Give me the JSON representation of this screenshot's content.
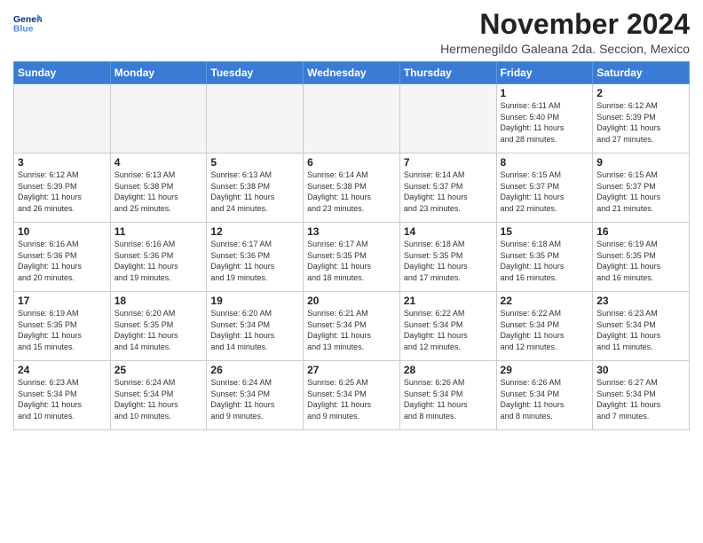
{
  "logo": {
    "line1": "General",
    "line2": "Blue"
  },
  "title": "November 2024",
  "location": "Hermenegildo Galeana 2da. Seccion, Mexico",
  "weekdays": [
    "Sunday",
    "Monday",
    "Tuesday",
    "Wednesday",
    "Thursday",
    "Friday",
    "Saturday"
  ],
  "weeks": [
    [
      {
        "day": "",
        "detail": ""
      },
      {
        "day": "",
        "detail": ""
      },
      {
        "day": "",
        "detail": ""
      },
      {
        "day": "",
        "detail": ""
      },
      {
        "day": "",
        "detail": ""
      },
      {
        "day": "1",
        "detail": "Sunrise: 6:11 AM\nSunset: 5:40 PM\nDaylight: 11 hours\nand 28 minutes."
      },
      {
        "day": "2",
        "detail": "Sunrise: 6:12 AM\nSunset: 5:39 PM\nDaylight: 11 hours\nand 27 minutes."
      }
    ],
    [
      {
        "day": "3",
        "detail": "Sunrise: 6:12 AM\nSunset: 5:39 PM\nDaylight: 11 hours\nand 26 minutes."
      },
      {
        "day": "4",
        "detail": "Sunrise: 6:13 AM\nSunset: 5:38 PM\nDaylight: 11 hours\nand 25 minutes."
      },
      {
        "day": "5",
        "detail": "Sunrise: 6:13 AM\nSunset: 5:38 PM\nDaylight: 11 hours\nand 24 minutes."
      },
      {
        "day": "6",
        "detail": "Sunrise: 6:14 AM\nSunset: 5:38 PM\nDaylight: 11 hours\nand 23 minutes."
      },
      {
        "day": "7",
        "detail": "Sunrise: 6:14 AM\nSunset: 5:37 PM\nDaylight: 11 hours\nand 23 minutes."
      },
      {
        "day": "8",
        "detail": "Sunrise: 6:15 AM\nSunset: 5:37 PM\nDaylight: 11 hours\nand 22 minutes."
      },
      {
        "day": "9",
        "detail": "Sunrise: 6:15 AM\nSunset: 5:37 PM\nDaylight: 11 hours\nand 21 minutes."
      }
    ],
    [
      {
        "day": "10",
        "detail": "Sunrise: 6:16 AM\nSunset: 5:36 PM\nDaylight: 11 hours\nand 20 minutes."
      },
      {
        "day": "11",
        "detail": "Sunrise: 6:16 AM\nSunset: 5:36 PM\nDaylight: 11 hours\nand 19 minutes."
      },
      {
        "day": "12",
        "detail": "Sunrise: 6:17 AM\nSunset: 5:36 PM\nDaylight: 11 hours\nand 19 minutes."
      },
      {
        "day": "13",
        "detail": "Sunrise: 6:17 AM\nSunset: 5:35 PM\nDaylight: 11 hours\nand 18 minutes."
      },
      {
        "day": "14",
        "detail": "Sunrise: 6:18 AM\nSunset: 5:35 PM\nDaylight: 11 hours\nand 17 minutes."
      },
      {
        "day": "15",
        "detail": "Sunrise: 6:18 AM\nSunset: 5:35 PM\nDaylight: 11 hours\nand 16 minutes."
      },
      {
        "day": "16",
        "detail": "Sunrise: 6:19 AM\nSunset: 5:35 PM\nDaylight: 11 hours\nand 16 minutes."
      }
    ],
    [
      {
        "day": "17",
        "detail": "Sunrise: 6:19 AM\nSunset: 5:35 PM\nDaylight: 11 hours\nand 15 minutes."
      },
      {
        "day": "18",
        "detail": "Sunrise: 6:20 AM\nSunset: 5:35 PM\nDaylight: 11 hours\nand 14 minutes."
      },
      {
        "day": "19",
        "detail": "Sunrise: 6:20 AM\nSunset: 5:34 PM\nDaylight: 11 hours\nand 14 minutes."
      },
      {
        "day": "20",
        "detail": "Sunrise: 6:21 AM\nSunset: 5:34 PM\nDaylight: 11 hours\nand 13 minutes."
      },
      {
        "day": "21",
        "detail": "Sunrise: 6:22 AM\nSunset: 5:34 PM\nDaylight: 11 hours\nand 12 minutes."
      },
      {
        "day": "22",
        "detail": "Sunrise: 6:22 AM\nSunset: 5:34 PM\nDaylight: 11 hours\nand 12 minutes."
      },
      {
        "day": "23",
        "detail": "Sunrise: 6:23 AM\nSunset: 5:34 PM\nDaylight: 11 hours\nand 11 minutes."
      }
    ],
    [
      {
        "day": "24",
        "detail": "Sunrise: 6:23 AM\nSunset: 5:34 PM\nDaylight: 11 hours\nand 10 minutes."
      },
      {
        "day": "25",
        "detail": "Sunrise: 6:24 AM\nSunset: 5:34 PM\nDaylight: 11 hours\nand 10 minutes."
      },
      {
        "day": "26",
        "detail": "Sunrise: 6:24 AM\nSunset: 5:34 PM\nDaylight: 11 hours\nand 9 minutes."
      },
      {
        "day": "27",
        "detail": "Sunrise: 6:25 AM\nSunset: 5:34 PM\nDaylight: 11 hours\nand 9 minutes."
      },
      {
        "day": "28",
        "detail": "Sunrise: 6:26 AM\nSunset: 5:34 PM\nDaylight: 11 hours\nand 8 minutes."
      },
      {
        "day": "29",
        "detail": "Sunrise: 6:26 AM\nSunset: 5:34 PM\nDaylight: 11 hours\nand 8 minutes."
      },
      {
        "day": "30",
        "detail": "Sunrise: 6:27 AM\nSunset: 5:34 PM\nDaylight: 11 hours\nand 7 minutes."
      }
    ]
  ]
}
